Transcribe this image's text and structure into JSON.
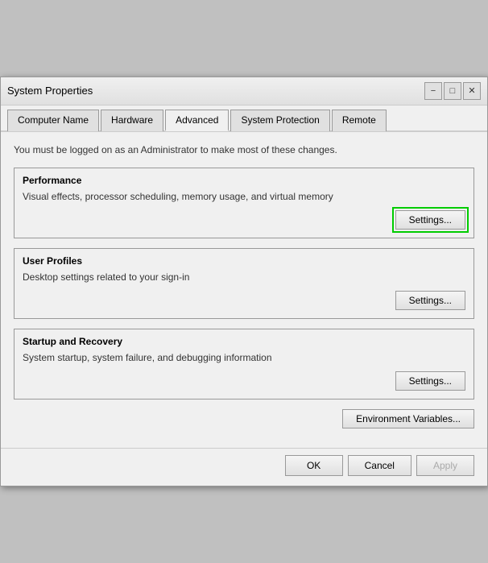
{
  "window": {
    "title": "System Properties",
    "close_label": "✕",
    "minimize_label": "−",
    "maximize_label": "□"
  },
  "tabs": [
    {
      "label": "Computer Name",
      "active": false
    },
    {
      "label": "Hardware",
      "active": false
    },
    {
      "label": "Advanced",
      "active": true
    },
    {
      "label": "System Protection",
      "active": false
    },
    {
      "label": "Remote",
      "active": false
    }
  ],
  "content": {
    "admin_notice": "You must be logged on as an Administrator to make most of these changes.",
    "performance": {
      "title": "Performance",
      "desc": "Visual effects, processor scheduling, memory usage, and virtual memory",
      "settings_label": "Settings...",
      "highlighted": true
    },
    "user_profiles": {
      "title": "User Profiles",
      "desc": "Desktop settings related to your sign-in",
      "settings_label": "Settings..."
    },
    "startup_recovery": {
      "title": "Startup and Recovery",
      "desc": "System startup, system failure, and debugging information",
      "settings_label": "Settings..."
    },
    "env_variables_label": "Environment Variables...",
    "ok_label": "OK",
    "cancel_label": "Cancel",
    "apply_label": "Apply"
  }
}
